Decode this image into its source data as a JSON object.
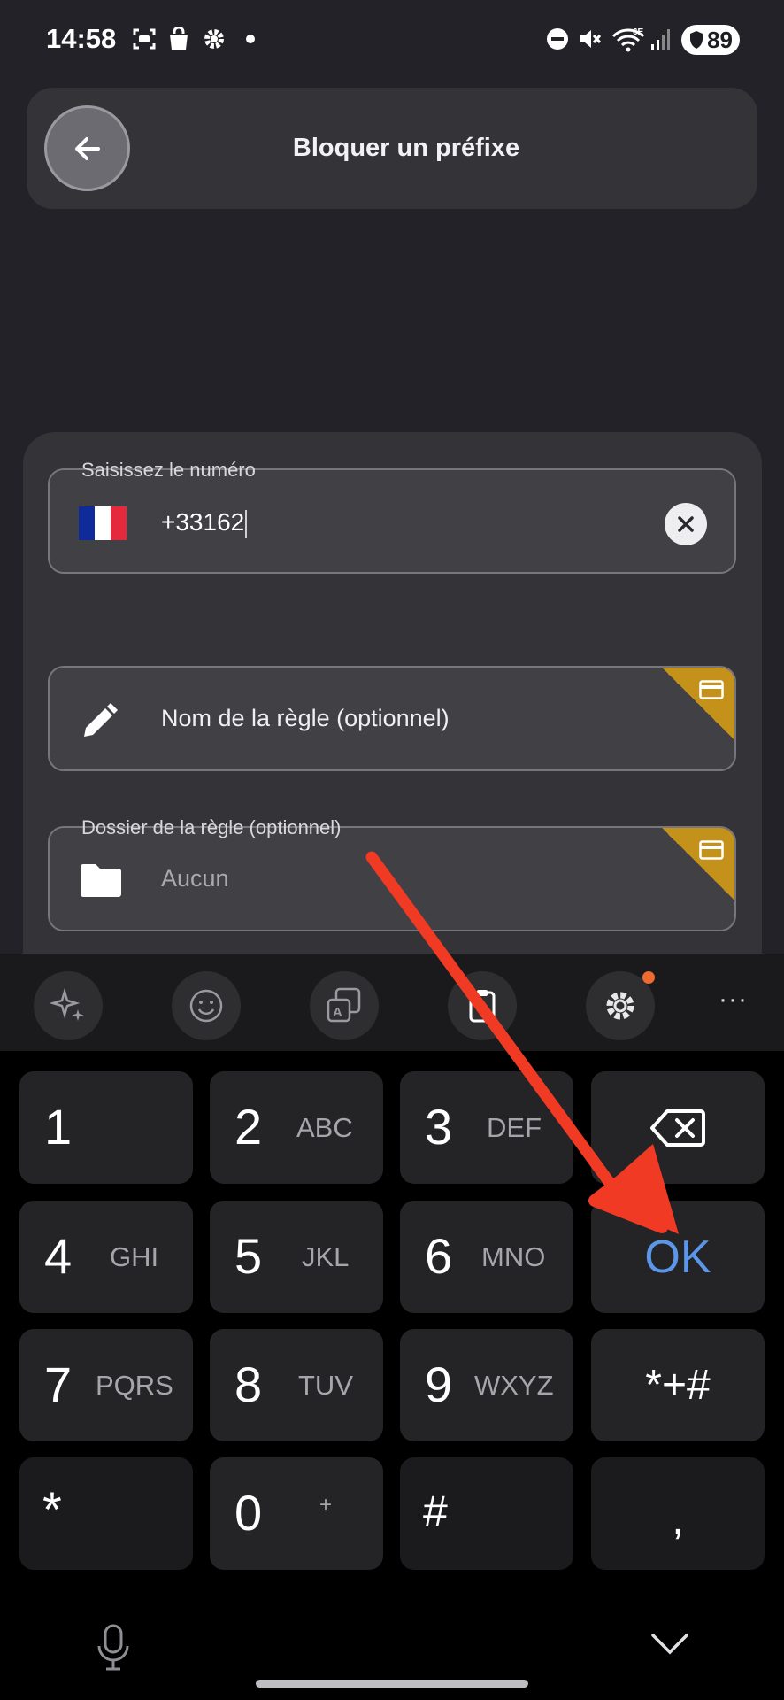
{
  "status_bar": {
    "time": "14:58",
    "battery": "89",
    "icons": [
      "screenshot-icon",
      "bag-icon",
      "settings-icon",
      "dot-icon",
      "do-not-disturb-icon",
      "mute-icon",
      "wifi-6e-icon",
      "signal-icon",
      "battery-icon"
    ]
  },
  "header": {
    "title": "Bloquer un préfixe",
    "back_icon": "arrow-left-icon"
  },
  "form": {
    "number_field": {
      "label": "Saisissez le numéro",
      "value": "+33162",
      "country_flag": "France",
      "flag_colors": [
        "#0f2a99",
        "#ffffff",
        "#e3293b"
      ]
    },
    "rule_name_field": {
      "placeholder": "Nom de la règle (optionnel)",
      "icon": "pencil-icon"
    },
    "rule_folder_field": {
      "label": "Dossier de la règle (optionnel)",
      "value": "Aucun",
      "icon": "folder-icon"
    },
    "premium_badge_color": "#c4921a"
  },
  "keyboard_toolbar": {
    "buttons": [
      "sparkle-icon",
      "emoji-icon",
      "translate-icon",
      "clipboard-icon",
      "keyboard-settings-icon"
    ],
    "more": "···"
  },
  "keypad": {
    "rows": [
      [
        {
          "digit": "1",
          "letters": ""
        },
        {
          "digit": "2",
          "letters": "ABC"
        },
        {
          "digit": "3",
          "letters": "DEF"
        },
        {
          "special": "backspace"
        }
      ],
      [
        {
          "digit": "4",
          "letters": "GHI"
        },
        {
          "digit": "5",
          "letters": "JKL"
        },
        {
          "digit": "6",
          "letters": "MNO"
        },
        {
          "special": "OK"
        }
      ],
      [
        {
          "digit": "7",
          "letters": "PQRS"
        },
        {
          "digit": "8",
          "letters": "TUV"
        },
        {
          "digit": "9",
          "letters": "WXYZ"
        },
        {
          "special": "*+#"
        }
      ],
      [
        {
          "digit": "*",
          "letters": ""
        },
        {
          "digit": "0",
          "letters": "+"
        },
        {
          "digit": "#",
          "letters": ""
        },
        {
          "special": ","
        }
      ]
    ],
    "ok_color": "#5b96e8"
  },
  "annotation": {
    "type": "arrow",
    "color": "#f03a24",
    "points_to": "OK key"
  }
}
